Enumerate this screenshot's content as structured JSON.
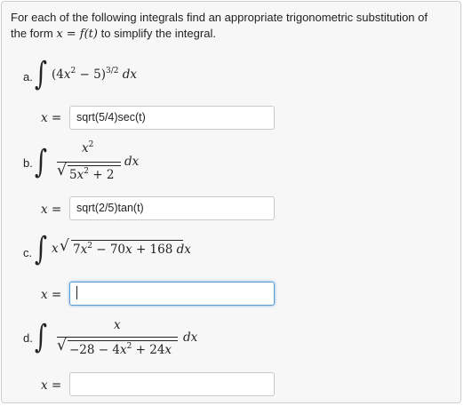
{
  "intro": {
    "line1": "For each of the following integrals find an appropriate trigonometric substitution of",
    "line2_prefix": "the form",
    "line2_formula": "x = f(t)",
    "line2_suffix": "to simplify the integral."
  },
  "problems": [
    {
      "label": "a.",
      "integrand": "(4x² − 5)^(3/2) dx",
      "answer_prefix": "x =",
      "answer_value": "sqrt(5/4)sec(t)"
    },
    {
      "label": "b.",
      "numerator": "x²",
      "denominator": "√(5x² + 2)",
      "differential": "dx",
      "answer_prefix": "x =",
      "answer_value": "sqrt(2/5)tan(t)"
    },
    {
      "label": "c.",
      "integrand": "x√(7x² − 70x + 168) dx",
      "answer_prefix": "x =",
      "answer_value": ""
    },
    {
      "label": "d.",
      "numerator": "x",
      "denominator": "√(−28 − 4x² + 24x)",
      "differential": "dx",
      "answer_prefix": "x =",
      "answer_value": ""
    }
  ]
}
